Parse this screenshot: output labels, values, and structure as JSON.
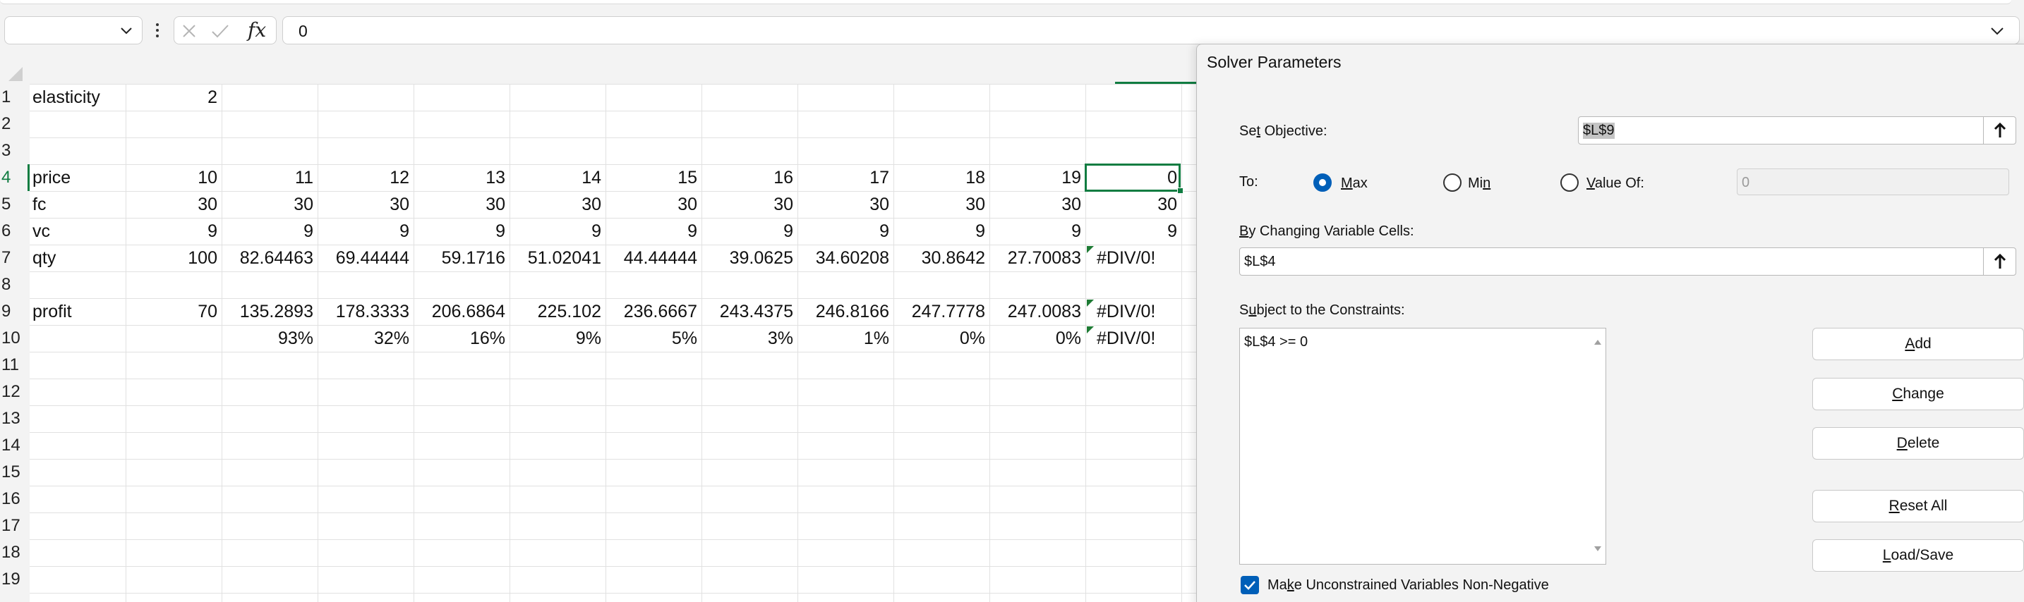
{
  "formula_bar": {
    "name_box": "",
    "fx_label": "fx",
    "formula_value": "0"
  },
  "row_numbers": [
    "1",
    "2",
    "3",
    "4",
    "5",
    "6",
    "7",
    "8",
    "9",
    "10",
    "11",
    "12",
    "13",
    "14",
    "15",
    "16",
    "17",
    "18",
    "19"
  ],
  "rows": [
    {
      "label": "elasticity",
      "cells": [
        "2",
        "",
        "",
        "",
        "",
        "",
        "",
        "",
        "",
        "",
        ""
      ]
    },
    {
      "label": "",
      "cells": [
        "",
        "",
        "",
        "",
        "",
        "",
        "",
        "",
        "",
        "",
        ""
      ]
    },
    {
      "label": "",
      "cells": [
        "",
        "",
        "",
        "",
        "",
        "",
        "",
        "",
        "",
        "",
        ""
      ]
    },
    {
      "label": "price",
      "cells": [
        "10",
        "11",
        "12",
        "13",
        "14",
        "15",
        "16",
        "17",
        "18",
        "19",
        "0"
      ]
    },
    {
      "label": "fc",
      "cells": [
        "30",
        "30",
        "30",
        "30",
        "30",
        "30",
        "30",
        "30",
        "30",
        "30",
        "30"
      ]
    },
    {
      "label": "vc",
      "cells": [
        "9",
        "9",
        "9",
        "9",
        "9",
        "9",
        "9",
        "9",
        "9",
        "9",
        "9"
      ]
    },
    {
      "label": "qty",
      "cells": [
        "100",
        "82.64463",
        "69.44444",
        "59.1716",
        "51.02041",
        "44.44444",
        "39.0625",
        "34.60208",
        "30.8642",
        "27.70083",
        "#DIV/0!"
      ]
    },
    {
      "label": "",
      "cells": [
        "",
        "",
        "",
        "",
        "",
        "",
        "",
        "",
        "",
        "",
        ""
      ]
    },
    {
      "label": "profit",
      "cells": [
        "70",
        "135.2893",
        "178.3333",
        "206.6864",
        "225.102",
        "236.6667",
        "243.4375",
        "246.8166",
        "247.7778",
        "247.0083",
        "#DIV/0!"
      ]
    },
    {
      "label": "",
      "cells": [
        "",
        "93%",
        "32%",
        "16%",
        "9%",
        "5%",
        "3%",
        "1%",
        "0%",
        "0%",
        "#DIV/0!"
      ]
    }
  ],
  "solver": {
    "title": "Solver Parameters",
    "set_objective_label_pre": "Se",
    "set_objective_label_key": "t",
    "set_objective_label_post": " Objective:",
    "objective_value": "$L$9",
    "to_label": "To:",
    "max_label_key": "M",
    "max_label_post": "ax",
    "min_label_pre": "Mi",
    "min_label_key": "n",
    "value_of_label_key": "V",
    "value_of_label_post": "alue Of:",
    "value_of_input": "0",
    "selected_option": "Max",
    "changing_cells_label_key": "B",
    "changing_cells_label_post": "y Changing Variable Cells:",
    "changing_cells_value": "$L$4",
    "constraints_label_pre": "S",
    "constraints_label_key": "u",
    "constraints_label_post": "bject to the Constraints:",
    "constraints": [
      "$L$4 >= 0"
    ],
    "add_key": "A",
    "add_post": "dd",
    "change_key": "C",
    "change_post": "hange",
    "delete_key": "D",
    "delete_post": "elete",
    "reset_key": "R",
    "reset_post": "eset All",
    "load_key": "L",
    "load_post": "oad/Save",
    "nonneg_pre": "Ma",
    "nonneg_key": "k",
    "nonneg_post": "e Unconstrained Variables Non-Negative",
    "nonneg_checked": true
  },
  "colors": {
    "accent_green": "#107c41",
    "accent_blue": "#005fb8",
    "error_triangle": "#1e7b34"
  }
}
